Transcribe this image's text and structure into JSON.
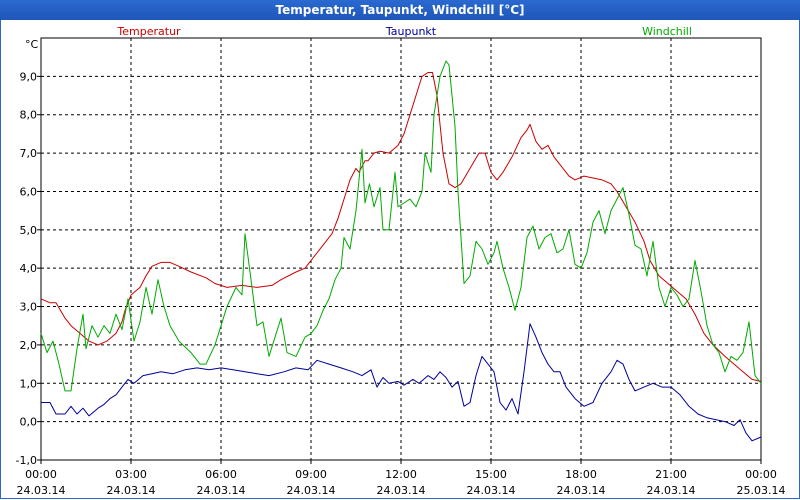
{
  "window": {
    "title": "Temperatur, Taupunkt, Windchill [°C]"
  },
  "chart_data": {
    "type": "line",
    "title": "Temperatur, Taupunkt, Windchill [°C]",
    "ylabel": "°C",
    "ylim": [
      -1.0,
      10.0
    ],
    "yticks": [
      "9,0",
      "8,0",
      "7,0",
      "6,0",
      "5,0",
      "4,0",
      "3,0",
      "2,0",
      "1,0",
      "0,0",
      "-1,0"
    ],
    "xlim_hours": [
      0,
      24
    ],
    "xticks": [
      {
        "time": "00:00",
        "date": "24.03.14"
      },
      {
        "time": "03:00",
        "date": "24.03.14"
      },
      {
        "time": "06:00",
        "date": "24.03.14"
      },
      {
        "time": "09:00",
        "date": "24.03.14"
      },
      {
        "time": "12:00",
        "date": "24.03.14"
      },
      {
        "time": "15:00",
        "date": "24.03.14"
      },
      {
        "time": "18:00",
        "date": "24.03.14"
      },
      {
        "time": "21:00",
        "date": "24.03.14"
      },
      {
        "time": "00:00",
        "date": "25.03.14"
      }
    ],
    "grid": true,
    "legend_position": "top",
    "series": [
      {
        "name": "Temperatur",
        "color": "#cc0000",
        "points": [
          [
            0,
            3.2
          ],
          [
            0.3,
            3.1
          ],
          [
            0.5,
            3.1
          ],
          [
            0.8,
            2.7
          ],
          [
            1,
            2.5
          ],
          [
            1.3,
            2.3
          ],
          [
            1.6,
            2.1
          ],
          [
            1.9,
            2.0
          ],
          [
            2.2,
            2.1
          ],
          [
            2.5,
            2.3
          ],
          [
            2.7,
            2.6
          ],
          [
            2.8,
            2.9
          ],
          [
            3,
            3.3
          ],
          [
            3.3,
            3.5
          ],
          [
            3.5,
            3.8
          ],
          [
            3.7,
            4.05
          ],
          [
            4,
            4.15
          ],
          [
            4.3,
            4.15
          ],
          [
            4.6,
            4.05
          ],
          [
            5,
            3.9
          ],
          [
            5.5,
            3.75
          ],
          [
            5.8,
            3.6
          ],
          [
            6.2,
            3.5
          ],
          [
            6.7,
            3.55
          ],
          [
            7.2,
            3.5
          ],
          [
            7.7,
            3.55
          ],
          [
            8,
            3.7
          ],
          [
            8.5,
            3.9
          ],
          [
            8.8,
            4.0
          ],
          [
            9.1,
            4.3
          ],
          [
            9.4,
            4.6
          ],
          [
            9.7,
            4.9
          ],
          [
            9.9,
            5.3
          ],
          [
            10.1,
            5.8
          ],
          [
            10.3,
            6.3
          ],
          [
            10.5,
            6.6
          ],
          [
            10.6,
            6.5
          ],
          [
            10.8,
            6.8
          ],
          [
            10.9,
            6.8
          ],
          [
            11.1,
            7.0
          ],
          [
            11.3,
            7.05
          ],
          [
            11.6,
            7.0
          ],
          [
            11.9,
            7.2
          ],
          [
            12.1,
            7.5
          ],
          [
            12.3,
            8.0
          ],
          [
            12.5,
            8.5
          ],
          [
            12.7,
            9.0
          ],
          [
            12.9,
            9.1
          ],
          [
            13.05,
            9.1
          ],
          [
            13.2,
            8.5
          ],
          [
            13.4,
            7.0
          ],
          [
            13.6,
            6.2
          ],
          [
            13.8,
            6.1
          ],
          [
            14.0,
            6.2
          ],
          [
            14.3,
            6.6
          ],
          [
            14.6,
            7.0
          ],
          [
            14.8,
            7.0
          ],
          [
            15.0,
            6.5
          ],
          [
            15.2,
            6.3
          ],
          [
            15.4,
            6.5
          ],
          [
            15.7,
            6.9
          ],
          [
            16.0,
            7.4
          ],
          [
            16.2,
            7.6
          ],
          [
            16.3,
            7.75
          ],
          [
            16.5,
            7.3
          ],
          [
            16.7,
            7.1
          ],
          [
            16.9,
            7.2
          ],
          [
            17.1,
            6.9
          ],
          [
            17.4,
            6.6
          ],
          [
            17.6,
            6.4
          ],
          [
            17.8,
            6.3
          ],
          [
            18.1,
            6.4
          ],
          [
            18.4,
            6.35
          ],
          [
            18.7,
            6.3
          ],
          [
            19.0,
            6.2
          ],
          [
            19.2,
            6.0
          ],
          [
            19.5,
            5.6
          ],
          [
            19.8,
            5.2
          ],
          [
            20.1,
            4.7
          ],
          [
            20.3,
            4.2
          ],
          [
            20.6,
            3.8
          ],
          [
            20.9,
            3.6
          ],
          [
            21.2,
            3.4
          ],
          [
            21.5,
            3.2
          ],
          [
            21.8,
            2.8
          ],
          [
            22.1,
            2.3
          ],
          [
            22.4,
            2.0
          ],
          [
            22.8,
            1.7
          ],
          [
            23.1,
            1.5
          ],
          [
            23.4,
            1.3
          ],
          [
            23.7,
            1.1
          ],
          [
            24.0,
            1.05
          ]
        ]
      },
      {
        "name": "Taupunkt",
        "color": "#000099",
        "points": [
          [
            0,
            0.5
          ],
          [
            0.3,
            0.5
          ],
          [
            0.5,
            0.2
          ],
          [
            0.8,
            0.2
          ],
          [
            1,
            0.4
          ],
          [
            1.2,
            0.2
          ],
          [
            1.4,
            0.35
          ],
          [
            1.6,
            0.15
          ],
          [
            1.9,
            0.35
          ],
          [
            2.1,
            0.45
          ],
          [
            2.3,
            0.6
          ],
          [
            2.5,
            0.7
          ],
          [
            2.7,
            0.9
          ],
          [
            2.9,
            1.1
          ],
          [
            3.1,
            1.0
          ],
          [
            3.4,
            1.2
          ],
          [
            3.7,
            1.25
          ],
          [
            4,
            1.3
          ],
          [
            4.4,
            1.25
          ],
          [
            4.8,
            1.35
          ],
          [
            5.2,
            1.4
          ],
          [
            5.6,
            1.35
          ],
          [
            6,
            1.4
          ],
          [
            6.4,
            1.35
          ],
          [
            6.8,
            1.3
          ],
          [
            7.2,
            1.25
          ],
          [
            7.6,
            1.2
          ],
          [
            8.1,
            1.3
          ],
          [
            8.5,
            1.4
          ],
          [
            8.9,
            1.35
          ],
          [
            9.2,
            1.6
          ],
          [
            9.6,
            1.5
          ],
          [
            10,
            1.4
          ],
          [
            10.4,
            1.3
          ],
          [
            10.7,
            1.2
          ],
          [
            11.0,
            1.35
          ],
          [
            11.2,
            0.9
          ],
          [
            11.4,
            1.15
          ],
          [
            11.6,
            1.0
          ],
          [
            11.9,
            1.05
          ],
          [
            12.1,
            0.95
          ],
          [
            12.4,
            1.1
          ],
          [
            12.6,
            1.0
          ],
          [
            12.9,
            1.2
          ],
          [
            13.1,
            1.1
          ],
          [
            13.3,
            1.3
          ],
          [
            13.5,
            1.15
          ],
          [
            13.7,
            0.9
          ],
          [
            13.9,
            1.05
          ],
          [
            14.1,
            0.4
          ],
          [
            14.3,
            0.5
          ],
          [
            14.5,
            1.2
          ],
          [
            14.7,
            1.7
          ],
          [
            14.9,
            1.5
          ],
          [
            15.1,
            1.3
          ],
          [
            15.3,
            0.5
          ],
          [
            15.5,
            0.3
          ],
          [
            15.7,
            0.6
          ],
          [
            15.9,
            0.2
          ],
          [
            16.1,
            1.3
          ],
          [
            16.3,
            2.55
          ],
          [
            16.5,
            2.2
          ],
          [
            16.7,
            1.8
          ],
          [
            16.9,
            1.5
          ],
          [
            17.1,
            1.3
          ],
          [
            17.3,
            1.3
          ],
          [
            17.5,
            0.9
          ],
          [
            17.8,
            0.6
          ],
          [
            18.1,
            0.4
          ],
          [
            18.4,
            0.5
          ],
          [
            18.7,
            1.0
          ],
          [
            19.0,
            1.3
          ],
          [
            19.2,
            1.6
          ],
          [
            19.4,
            1.5
          ],
          [
            19.6,
            1.1
          ],
          [
            19.8,
            0.8
          ],
          [
            20.1,
            0.9
          ],
          [
            20.4,
            1.0
          ],
          [
            20.7,
            0.9
          ],
          [
            21.0,
            0.9
          ],
          [
            21.3,
            0.7
          ],
          [
            21.6,
            0.4
          ],
          [
            21.9,
            0.2
          ],
          [
            22.2,
            0.1
          ],
          [
            22.5,
            0.05
          ],
          [
            22.8,
            0.0
          ],
          [
            23.1,
            -0.1
          ],
          [
            23.3,
            0.05
          ],
          [
            23.5,
            -0.3
          ],
          [
            23.7,
            -0.5
          ],
          [
            24.0,
            -0.4
          ]
        ]
      },
      {
        "name": "Windchill",
        "color": "#00aa00",
        "points": [
          [
            0,
            2.3
          ],
          [
            0.2,
            1.8
          ],
          [
            0.4,
            2.1
          ],
          [
            0.6,
            1.5
          ],
          [
            0.8,
            0.8
          ],
          [
            1.0,
            0.8
          ],
          [
            1.2,
            1.9
          ],
          [
            1.4,
            2.8
          ],
          [
            1.5,
            1.9
          ],
          [
            1.7,
            2.5
          ],
          [
            1.9,
            2.2
          ],
          [
            2.1,
            2.5
          ],
          [
            2.3,
            2.3
          ],
          [
            2.5,
            2.8
          ],
          [
            2.7,
            2.4
          ],
          [
            2.9,
            3.2
          ],
          [
            3.1,
            2.1
          ],
          [
            3.3,
            2.6
          ],
          [
            3.5,
            3.5
          ],
          [
            3.7,
            2.8
          ],
          [
            3.9,
            3.7
          ],
          [
            4.1,
            3.0
          ],
          [
            4.3,
            2.5
          ],
          [
            4.6,
            2.1
          ],
          [
            5,
            1.8
          ],
          [
            5.3,
            1.5
          ],
          [
            5.5,
            1.5
          ],
          [
            5.8,
            2.0
          ],
          [
            6.0,
            2.5
          ],
          [
            6.2,
            3.0
          ],
          [
            6.5,
            3.5
          ],
          [
            6.7,
            3.3
          ],
          [
            6.8,
            4.9
          ],
          [
            7.0,
            3.7
          ],
          [
            7.2,
            2.5
          ],
          [
            7.4,
            2.6
          ],
          [
            7.6,
            1.7
          ],
          [
            7.8,
            2.2
          ],
          [
            8.0,
            2.7
          ],
          [
            8.2,
            1.8
          ],
          [
            8.5,
            1.7
          ],
          [
            8.8,
            2.2
          ],
          [
            9.0,
            2.3
          ],
          [
            9.2,
            2.5
          ],
          [
            9.4,
            2.9
          ],
          [
            9.6,
            3.2
          ],
          [
            9.8,
            3.7
          ],
          [
            10.0,
            4.0
          ],
          [
            10.1,
            4.8
          ],
          [
            10.3,
            4.5
          ],
          [
            10.5,
            5.5
          ],
          [
            10.7,
            7.1
          ],
          [
            10.8,
            5.7
          ],
          [
            10.95,
            6.2
          ],
          [
            11.1,
            5.6
          ],
          [
            11.3,
            6.1
          ],
          [
            11.4,
            5.0
          ],
          [
            11.6,
            5.0
          ],
          [
            11.8,
            6.5
          ],
          [
            11.9,
            5.6
          ],
          [
            12.1,
            5.7
          ],
          [
            12.3,
            5.8
          ],
          [
            12.5,
            5.6
          ],
          [
            12.7,
            6.0
          ],
          [
            12.8,
            7.0
          ],
          [
            13.0,
            6.5
          ],
          [
            13.1,
            8.0
          ],
          [
            13.2,
            8.5
          ],
          [
            13.3,
            9.0
          ],
          [
            13.5,
            9.4
          ],
          [
            13.6,
            9.3
          ],
          [
            13.8,
            7.7
          ],
          [
            13.9,
            6.0
          ],
          [
            14.1,
            3.6
          ],
          [
            14.3,
            3.8
          ],
          [
            14.5,
            4.7
          ],
          [
            14.7,
            4.5
          ],
          [
            14.9,
            4.1
          ],
          [
            15.1,
            4.4
          ],
          [
            15.2,
            4.7
          ],
          [
            15.4,
            4.0
          ],
          [
            15.6,
            3.5
          ],
          [
            15.8,
            2.9
          ],
          [
            16.0,
            3.5
          ],
          [
            16.2,
            4.8
          ],
          [
            16.4,
            5.1
          ],
          [
            16.6,
            4.5
          ],
          [
            16.8,
            4.8
          ],
          [
            17.0,
            4.9
          ],
          [
            17.2,
            4.4
          ],
          [
            17.4,
            4.5
          ],
          [
            17.6,
            5.0
          ],
          [
            17.8,
            4.1
          ],
          [
            18.0,
            4.0
          ],
          [
            18.2,
            4.4
          ],
          [
            18.4,
            5.2
          ],
          [
            18.6,
            5.5
          ],
          [
            18.8,
            4.9
          ],
          [
            19.0,
            5.5
          ],
          [
            19.2,
            5.8
          ],
          [
            19.4,
            6.1
          ],
          [
            19.6,
            5.4
          ],
          [
            19.8,
            4.6
          ],
          [
            20.0,
            4.5
          ],
          [
            20.2,
            3.8
          ],
          [
            20.4,
            4.7
          ],
          [
            20.6,
            3.5
          ],
          [
            20.8,
            3.0
          ],
          [
            21.0,
            3.5
          ],
          [
            21.2,
            3.3
          ],
          [
            21.4,
            3.0
          ],
          [
            21.6,
            3.2
          ],
          [
            21.8,
            4.2
          ],
          [
            22.0,
            3.4
          ],
          [
            22.2,
            2.5
          ],
          [
            22.4,
            2.0
          ],
          [
            22.6,
            1.8
          ],
          [
            22.8,
            1.3
          ],
          [
            23.0,
            1.7
          ],
          [
            23.2,
            1.6
          ],
          [
            23.4,
            1.8
          ],
          [
            23.6,
            2.6
          ],
          [
            23.8,
            1.2
          ],
          [
            24.0,
            1.0
          ]
        ]
      }
    ]
  }
}
